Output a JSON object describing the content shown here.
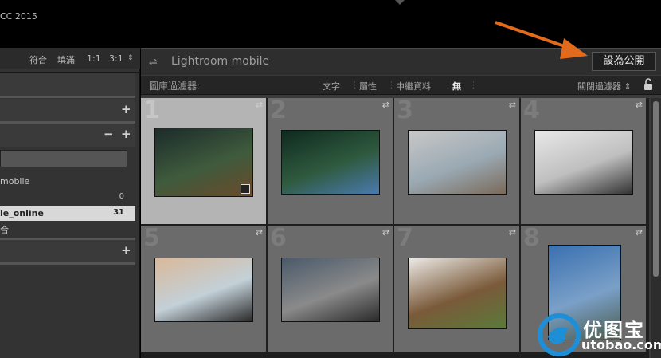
{
  "app": {
    "title_fragment": "CC 2015"
  },
  "left_panel": {
    "zoom_options": [
      "符合",
      "填滿",
      "1:1",
      "3:1"
    ],
    "collections": [
      {
        "label": "mobile",
        "count": ""
      },
      {
        "label": "",
        "count": "0"
      },
      {
        "label": "le_online",
        "count": "31",
        "selected": true
      },
      {
        "label": "合",
        "count": ""
      }
    ]
  },
  "header": {
    "title": "Lightroom mobile",
    "publish_label": "設為公開"
  },
  "filter": {
    "label": "圖庫過濾器:",
    "options": [
      "文字",
      "屬性",
      "中繼資料",
      "無"
    ],
    "active": "無",
    "close_label": "關閉過濾器"
  },
  "grid": {
    "cells": [
      {
        "num": "1",
        "selected": true,
        "image": "forest-sitting-woman",
        "colors": [
          "#1b2b2a",
          "#3f5b3d",
          "#6a4a2a"
        ]
      },
      {
        "num": "2",
        "selected": false,
        "image": "woman-with-camera",
        "colors": [
          "#0f2a1f",
          "#2f5a3f",
          "#4a7ab0"
        ]
      },
      {
        "num": "3",
        "selected": false,
        "image": "street-couple",
        "colors": [
          "#c8c8c8",
          "#9aa9b3",
          "#7a6a5a"
        ]
      },
      {
        "num": "4",
        "selected": false,
        "image": "white-corridor-woman",
        "colors": [
          "#e8e8e8",
          "#bfbfbf",
          "#333333"
        ]
      },
      {
        "num": "5",
        "selected": false,
        "image": "sunset-phone",
        "colors": [
          "#d9b99a",
          "#c3d0d8",
          "#2a2a2a"
        ]
      },
      {
        "num": "6",
        "selected": false,
        "image": "skyscraper-feet",
        "colors": [
          "#4a5a6a",
          "#8a8a8a",
          "#2a2a2a"
        ]
      },
      {
        "num": "7",
        "selected": false,
        "image": "field-landscape",
        "colors": [
          "#eceae6",
          "#7a5a3a",
          "#5a7a3a"
        ]
      },
      {
        "num": "8",
        "selected": false,
        "image": "mountain-sky",
        "colors": [
          "#3a70b0",
          "#7aa0c8",
          "#4a5a4a"
        ]
      }
    ]
  },
  "watermark": {
    "brand": "优图宝",
    "url": "utobao.com",
    "accent": "#1e8fd6"
  },
  "annotation": {
    "arrow_color": "#e26a1c"
  }
}
